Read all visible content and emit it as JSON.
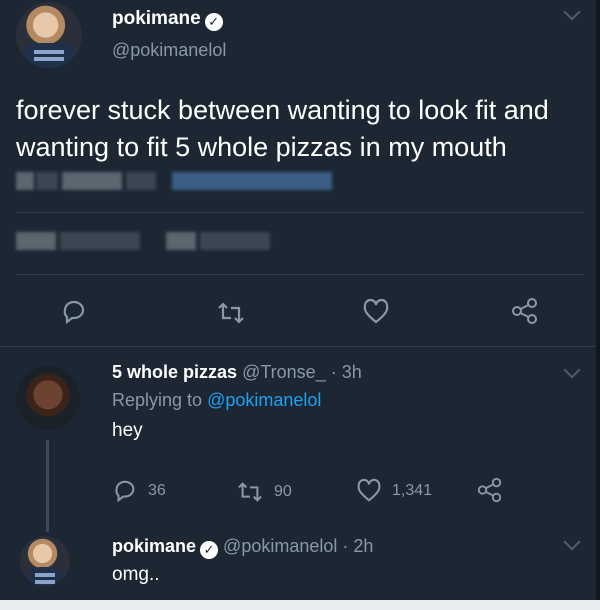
{
  "main_tweet": {
    "name": "pokimane",
    "handle": "@pokimanelol",
    "text": "forever stuck between wanting to look fit and wanting to fit 5 whole pizzas in my mouth"
  },
  "reply": {
    "name": "5 whole pizzas",
    "handle": "@Tronse_",
    "time": "· 3h",
    "replying_prefix": "Replying to",
    "replying_handle": "@pokimanelol",
    "text": "hey",
    "replies_count": "36",
    "retweets_count": "90",
    "likes_count": "1,341"
  },
  "second_reply": {
    "name": "pokimane",
    "handle_time": "@pokimanelol · 2h",
    "text": "omg.."
  },
  "icons": {
    "reply": "reply-icon",
    "retweet": "retweet-icon",
    "like": "heart-icon",
    "share": "share-icon",
    "verified": "verified-badge-icon",
    "caret": "chevron-down-icon"
  },
  "colors": {
    "background": "#1c2733",
    "secondary_text": "#8899a6",
    "link": "#1da1f2"
  }
}
